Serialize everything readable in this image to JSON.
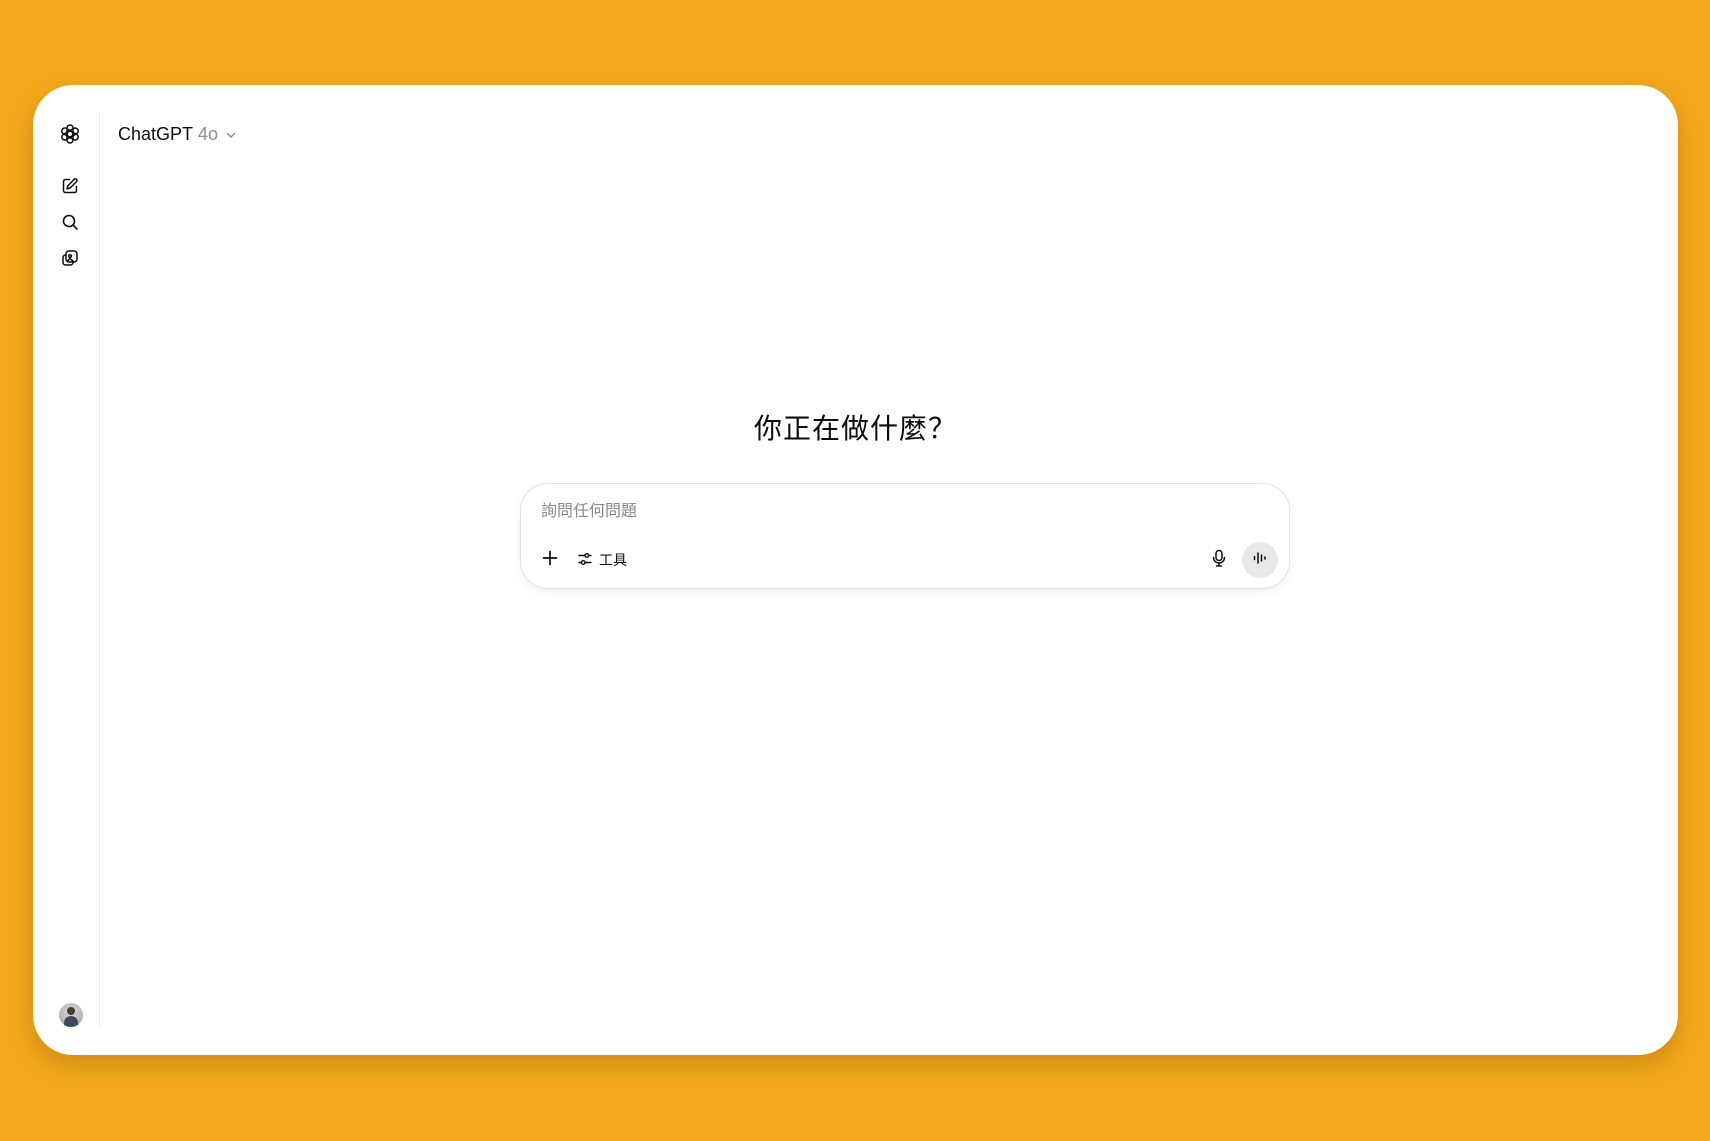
{
  "header": {
    "model_name": "ChatGPT",
    "model_version": "4o"
  },
  "sidebar": {
    "items": [
      {
        "icon": "openai-logo-icon"
      },
      {
        "icon": "new-chat-icon"
      },
      {
        "icon": "search-icon"
      },
      {
        "icon": "library-icon"
      }
    ],
    "user_avatar": "avatar"
  },
  "main": {
    "greeting": "你正在做什麼？"
  },
  "composer": {
    "placeholder": "詢問任何問題",
    "value": "",
    "tools_label": "工具"
  },
  "colors": {
    "background": "#F3A81B",
    "window": "#FFFFFF",
    "text": "#0D0D0D",
    "muted": "#8F8F8F",
    "voice_button_bg": "#E8E8E8"
  }
}
